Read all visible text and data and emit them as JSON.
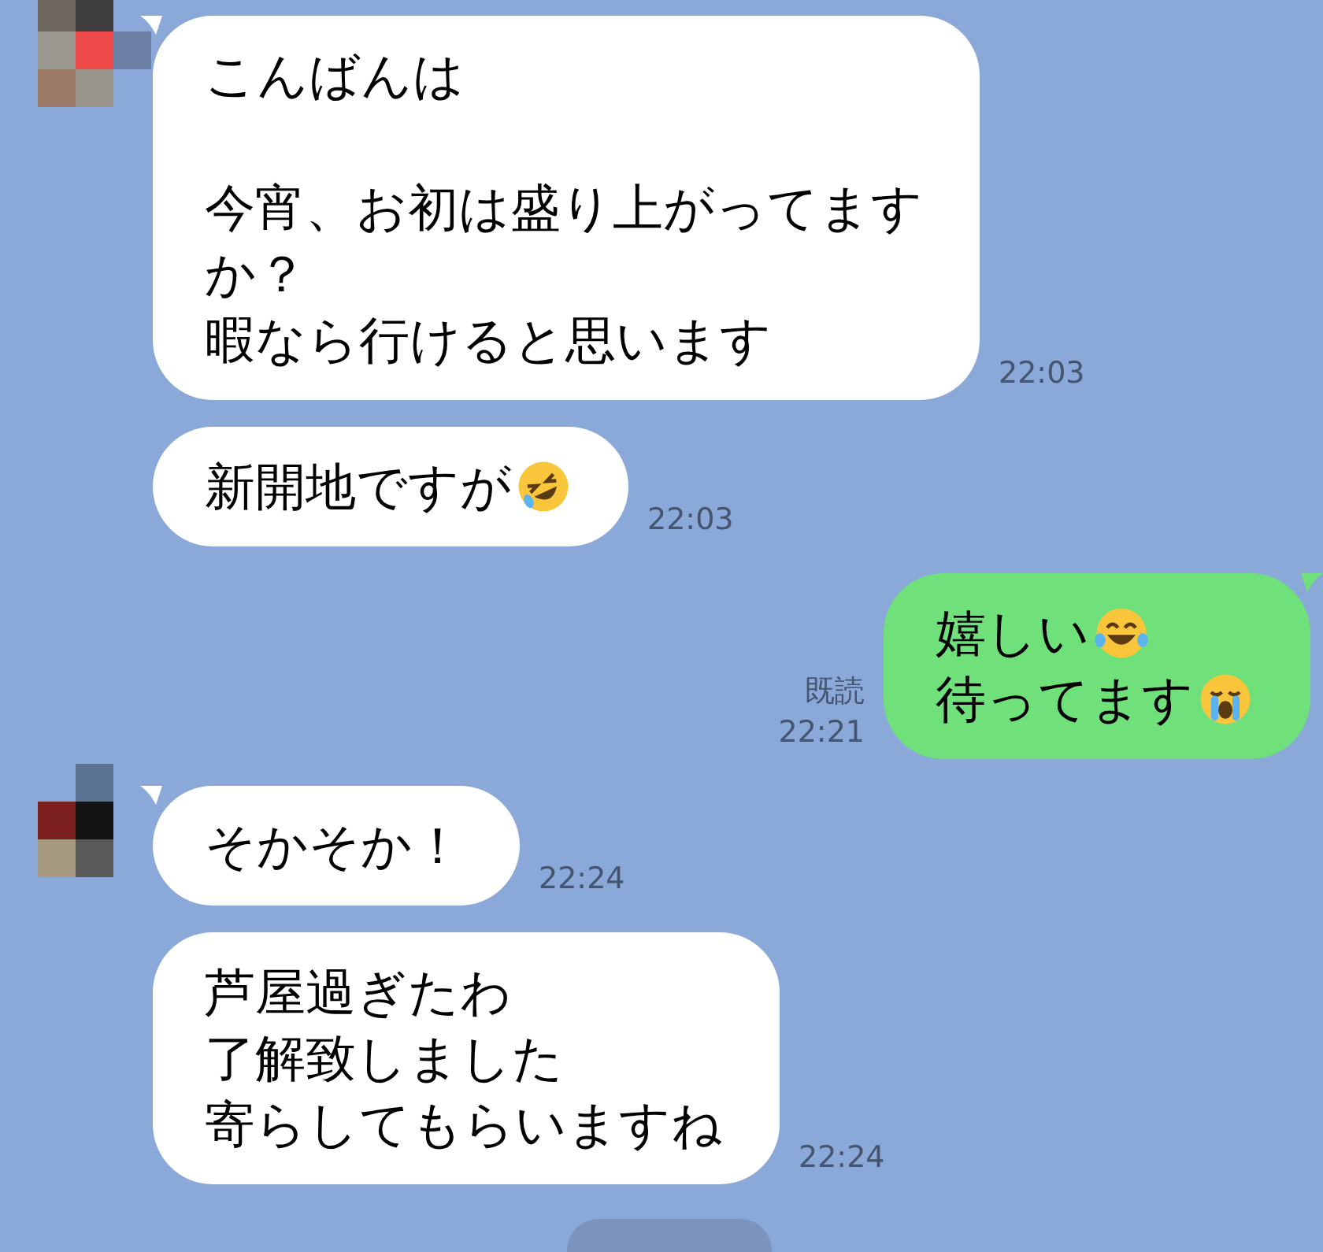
{
  "messages": [
    {
      "kind": "incoming",
      "avatar": {
        "kind": "mosaic_a"
      },
      "tail": true,
      "time": "22:03",
      "paragraphs": [
        {
          "lines": [
            {
              "text": "こんばんは"
            }
          ]
        },
        {
          "lines": [
            {
              "text": "今宵、お初は盛り上がってます"
            },
            {
              "text": "か？"
            },
            {
              "text": "暇なら行けると思います"
            }
          ]
        }
      ]
    },
    {
      "kind": "incoming",
      "tail": false,
      "time": "22:03",
      "paragraphs": [
        {
          "lines": [
            {
              "text": "新開地ですが",
              "emoji": {
                "kind": "rofl"
              }
            }
          ]
        }
      ]
    },
    {
      "kind": "outgoing",
      "tail": true,
      "read": "既読",
      "time": "22:21",
      "paragraphs": [
        {
          "lines": [
            {
              "text": "嬉しい",
              "emoji": {
                "kind": "joy"
              }
            },
            {
              "text": "待ってます",
              "emoji": {
                "kind": "sob"
              }
            }
          ]
        }
      ]
    },
    {
      "kind": "incoming",
      "avatar": {
        "kind": "mosaic_b"
      },
      "tail": true,
      "time": "22:24",
      "paragraphs": [
        {
          "lines": [
            {
              "text": "そかそか！"
            }
          ]
        }
      ]
    },
    {
      "kind": "incoming",
      "tail": false,
      "time": "22:24",
      "paragraphs": [
        {
          "lines": [
            {
              "text": "芦屋過ぎたわ"
            },
            {
              "text": "了解致しました"
            },
            {
              "text": "寄らしてもらいますね"
            }
          ]
        }
      ]
    }
  ],
  "date_pill": {
    "kind": "pill"
  }
}
